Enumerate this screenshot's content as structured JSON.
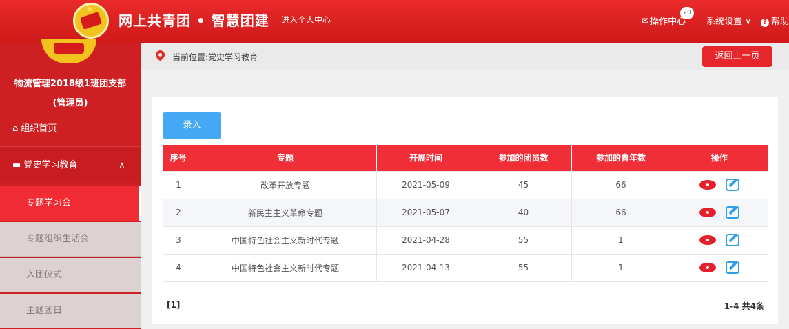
{
  "header": {
    "brand": "网上共青团 • 智慧团建",
    "enter_center": "进入个人中心",
    "ops_center": "操作中心",
    "ops_badge": "20",
    "settings": "系统设置",
    "help": "帮助"
  },
  "sidebar": {
    "org_name_line1": "物流管理2018级1班团支部",
    "org_name_line2": "(管理员)",
    "home": "组织首页",
    "party_history": "党史学习教育",
    "sub_items": [
      "专题学习会",
      "专题组织生活会",
      "入团仪式",
      "主题团日"
    ]
  },
  "breadcrumb": {
    "text": "当前位置:党史学习教育",
    "back_button": "返回上一页"
  },
  "main": {
    "add_button": "录入",
    "columns": [
      "序号",
      "专题",
      "开展时间",
      "参加的团员数",
      "参加的青年数",
      "操作"
    ],
    "rows": [
      {
        "no": "1",
        "topic": "改革开放专题",
        "date": "2021-05-09",
        "members": "45",
        "youth": "66"
      },
      {
        "no": "2",
        "topic": "新民主主义革命专题",
        "date": "2021-05-07",
        "members": "40",
        "youth": "66"
      },
      {
        "no": "3",
        "topic": "中国特色社会主义新时代专题",
        "date": "2021-04-28",
        "members": "55",
        "youth": "1"
      },
      {
        "no": "4",
        "topic": "中国特色社会主义新时代专题",
        "date": "2021-04-13",
        "members": "55",
        "youth": "1"
      }
    ],
    "pager_left": "[1]",
    "pager_right": "1-4 共4条"
  },
  "colors": {
    "header_red": "#d41d1d",
    "table_header": "#ef2e38",
    "add_button": "#45a9f5",
    "eye_icon": "#e41f2a",
    "edit_icon": "#2f9fe9"
  }
}
